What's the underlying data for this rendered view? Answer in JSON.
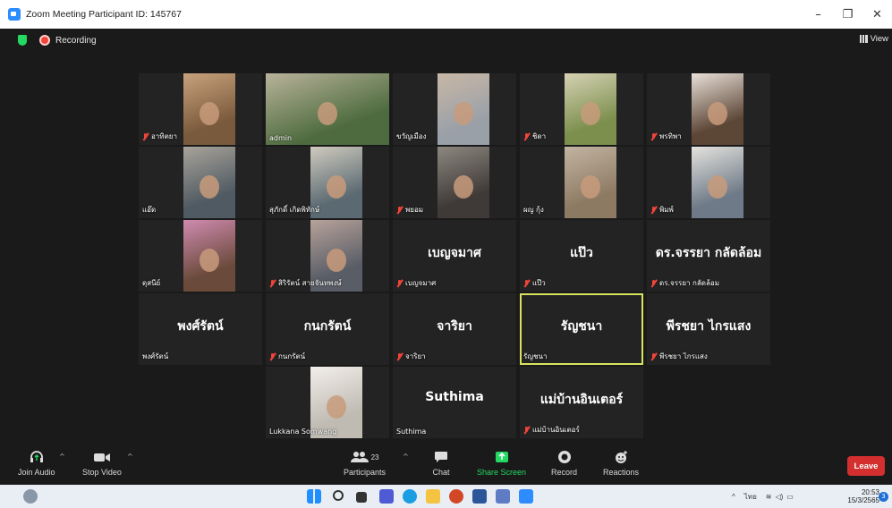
{
  "window": {
    "title": "Zoom Meeting Participant ID: 145767",
    "minimize": "–",
    "restore": "❐",
    "close": "✕"
  },
  "topbar": {
    "recording_label": "Recording",
    "view_label": "View"
  },
  "tiles": [
    {
      "name": "อาทิตยา",
      "muted": true,
      "video": true
    },
    {
      "name": "admin",
      "muted": false,
      "video": true
    },
    {
      "name": "ขวัญเมือง",
      "muted": false,
      "video": true
    },
    {
      "name": "ชิดา",
      "muted": true,
      "video": true
    },
    {
      "name": "พรทิพา",
      "muted": true,
      "video": true
    },
    {
      "name": "แอ๊ด",
      "muted": false,
      "video": true
    },
    {
      "name": "สุภักดิ์ เกิดพิทักษ์",
      "muted": false,
      "video": true
    },
    {
      "name": "พยอม",
      "muted": true,
      "video": true
    },
    {
      "name": "ผญ กุ้ง",
      "muted": false,
      "video": true
    },
    {
      "name": "พิมพ์",
      "muted": true,
      "video": true
    },
    {
      "name": "ดุสนีย์",
      "muted": false,
      "video": true
    },
    {
      "name": "สิริรัตน์ สายจันทพงษ์",
      "muted": true,
      "video": true
    },
    {
      "name": "เบญจมาศ",
      "display": "เบญจมาศ",
      "muted": true,
      "video": false
    },
    {
      "name": "แป๊ว",
      "display": "แป๊ว",
      "muted": true,
      "video": false
    },
    {
      "name": "ดร.จรรยา กลัดล้อม",
      "display": "ดร.จรรยา กลัดล้อม",
      "muted": true,
      "video": false
    },
    {
      "name": "พงศ์รัตน์",
      "display": "พงศ์รัตน์",
      "muted": false,
      "video": false
    },
    {
      "name": "กนกรัตน์",
      "display": "กนกรัตน์",
      "muted": true,
      "video": false
    },
    {
      "name": "จาริยา",
      "display": "จาริยา",
      "muted": true,
      "video": false
    },
    {
      "name": "รัญชนา",
      "display": "รัญชนา",
      "muted": false,
      "video": false,
      "active": true
    },
    {
      "name": "พีรชยา ไกรแสง",
      "display": "พีรชยา ไกรแสง",
      "muted": true,
      "video": false
    },
    {
      "name": "Lukkana Somwang",
      "muted": false,
      "video": true
    },
    {
      "name": "Suthima",
      "display": "Suthima",
      "muted": false,
      "video": false
    },
    {
      "name": "แม่บ้านอินเตอร์",
      "display": "แม่บ้านอินเตอร์",
      "muted": true,
      "video": false
    }
  ],
  "toolbar": {
    "join_audio": "Join Audio",
    "stop_video": "Stop Video",
    "participants": "Participants",
    "participants_count": "23",
    "chat": "Chat",
    "share_screen": "Share Screen",
    "record": "Record",
    "reactions": "Reactions",
    "leave": "Leave"
  },
  "taskbar": {
    "language": "ไทย",
    "time": "20:53",
    "date": "15/3/2565",
    "notifications": "3"
  },
  "colors": {
    "accent": "#2d8cff",
    "recording": "#f2453a",
    "active_speaker": "#d7e35f",
    "leave": "#d32f2f",
    "share": "#23d962"
  }
}
